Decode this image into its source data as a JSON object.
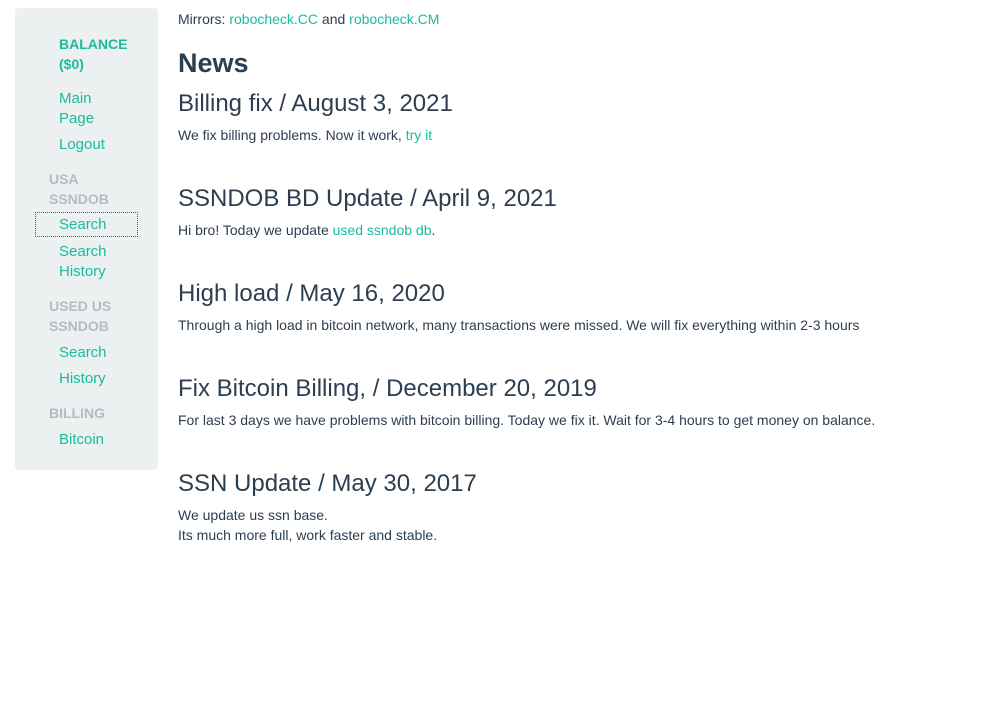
{
  "sidebar": {
    "balance": [
      "BALANCE",
      "($0)"
    ],
    "main_page": [
      "Main",
      "Page"
    ],
    "logout": "Logout",
    "sections": [
      {
        "header": [
          "USA",
          "SSNDOB"
        ],
        "links": [
          {
            "label": [
              "Search"
            ],
            "active": true
          },
          {
            "label": [
              "Search",
              "History"
            ]
          }
        ]
      },
      {
        "header": [
          "USED US",
          "SSNDOB"
        ],
        "links": [
          {
            "label": [
              "Search"
            ]
          },
          {
            "label": [
              "History"
            ]
          }
        ]
      },
      {
        "header": [
          "BILLING"
        ],
        "links": [
          {
            "label": [
              "Bitcoin"
            ]
          }
        ]
      }
    ]
  },
  "mirrors": {
    "label": "Mirrors:",
    "link1": "robocheck.CC",
    "conj": "and",
    "link2": "robocheck.CM"
  },
  "page_title": "News",
  "news": [
    {
      "title": "Billing fix / August 3, 2021",
      "text": "We fix billing problems. Now it work,",
      "link": "try it"
    },
    {
      "title": "SSNDOB BD Update / April 9, 2021",
      "text": "Hi bro! Today we update",
      "link": "used ssndob db",
      "after": "."
    },
    {
      "title": "High load / May 16, 2020",
      "text": "Through a high load in bitcoin network, many transactions were missed. We will fix everything within 2-3 hours"
    },
    {
      "title": "Fix Bitcoin Billing, / December 20, 2019",
      "text": "For last 3 days we have problems with bitcoin billing. Today we fix it. Wait for 3-4 hours to get money on balance."
    },
    {
      "title": "SSN Update / May 30, 2017",
      "lines": [
        "We update us ssn base.",
        "Its much more full, work faster and stable."
      ]
    }
  ]
}
